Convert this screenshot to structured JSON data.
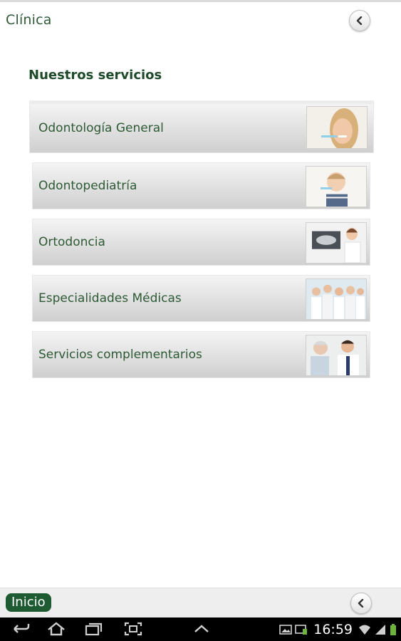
{
  "header": {
    "title": "Clínica"
  },
  "section": {
    "title": "Nuestros servicios"
  },
  "services": [
    {
      "label": "Odontología General",
      "image": "smiling-woman-toothbrush"
    },
    {
      "label": "Odontopediatría",
      "image": "child-brushing-teeth"
    },
    {
      "label": "Ortodoncia",
      "image": "dentist-xray"
    },
    {
      "label": "Especialidades Médicas",
      "image": "medical-team"
    },
    {
      "label": "Servicios complementarios",
      "image": "doctor-with-patient"
    }
  ],
  "bottom_bar": {
    "home_label": "Inicio"
  },
  "status_bar": {
    "time": "16:59"
  },
  "colors": {
    "brand_green": "#1e5a32",
    "text_green": "#2d5a35"
  },
  "icons": {
    "back": "chevron-left-icon",
    "nav": [
      "back-arrow-icon",
      "home-icon",
      "recent-apps-icon",
      "screenshot-icon",
      "caret-up-icon"
    ],
    "status": [
      "gallery-icon",
      "cast-icon",
      "wifi-icon",
      "signal-icon",
      "battery-icon"
    ]
  }
}
